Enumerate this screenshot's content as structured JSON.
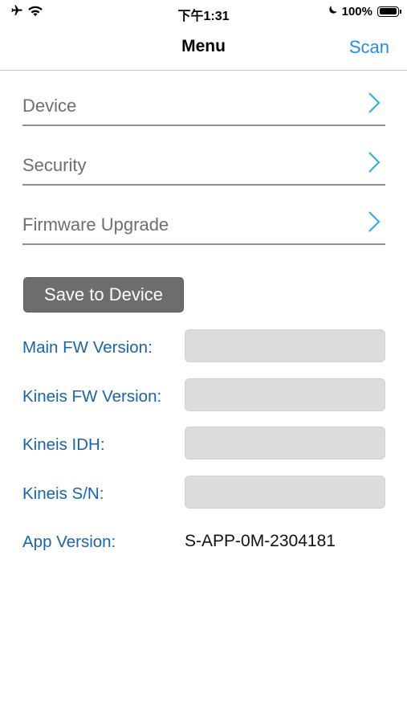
{
  "status_bar": {
    "time": "下午1:31",
    "battery_percent_label": "100%",
    "battery_level": 1.0,
    "icons": [
      "airplane-icon",
      "wifi-icon",
      "moon-icon",
      "battery-icon"
    ]
  },
  "nav": {
    "title": "Menu",
    "scan_label": "Scan",
    "accent_color": "#1e8fe4"
  },
  "menu": {
    "items": [
      {
        "label": "Device",
        "icon": "chevron-right-icon"
      },
      {
        "label": "Security",
        "icon": "chevron-right-icon"
      },
      {
        "label": "Firmware Upgrade",
        "icon": "chevron-right-icon"
      }
    ],
    "chevron_color": "#2aa8e8"
  },
  "actions": {
    "save_label": "Save to Device"
  },
  "info": {
    "main_fw_version_label": "Main FW Version:",
    "main_fw_version_value": "",
    "kineis_fw_version_label": "Kineis FW Version:",
    "kineis_fw_version_value": "",
    "kineis_idh_label": "Kineis IDH:",
    "kineis_idh_value": "",
    "kineis_sn_label": "Kineis S/N:",
    "kineis_sn_value": "",
    "app_version_label": "App Version:",
    "app_version_value": "S-APP-0M-2304181",
    "label_color": "#1a64a8"
  }
}
